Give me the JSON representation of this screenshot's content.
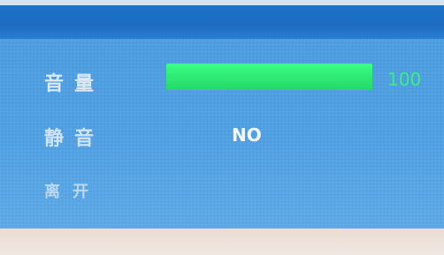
{
  "menu": {
    "items": [
      {
        "label": "音量"
      },
      {
        "label": "静音"
      },
      {
        "label": "离开"
      }
    ],
    "volume": {
      "value_text": "100",
      "level_fraction": 1.0
    },
    "mute": {
      "value_text": "NO"
    }
  },
  "colors": {
    "title_bar": "#1d6cc2",
    "panel": "#4c9ee3",
    "volume_bar": "#2ee874",
    "volume_value": "#38f07c",
    "label_text": "#cfe4f6"
  }
}
